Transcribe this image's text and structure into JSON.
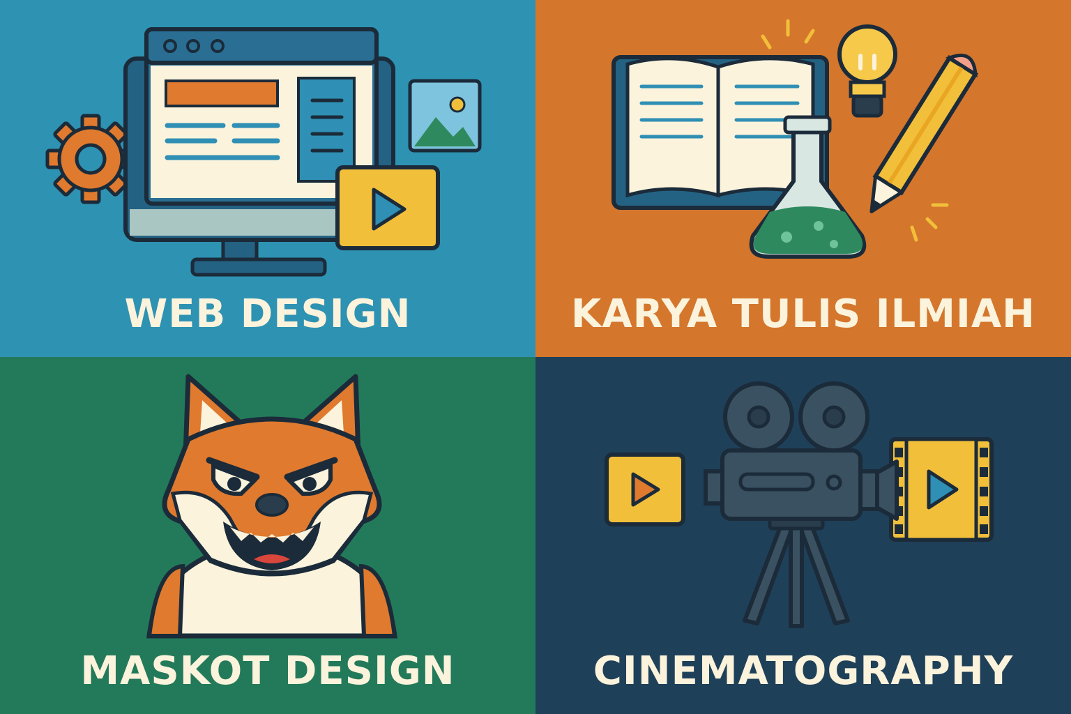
{
  "tiles": [
    {
      "label": "WEB DESIGN",
      "bg": "#2E92B2",
      "icon": "monitor-webpage-icon"
    },
    {
      "label": "KARYA TULIS ILMIAH",
      "bg": "#D4762C",
      "icon": "book-flask-pencil-icon"
    },
    {
      "label": "MASKOT DESIGN",
      "bg": "#237A5A",
      "icon": "fox-mascot-icon"
    },
    {
      "label": "CINEMATOGRAPHY",
      "bg": "#1F4059",
      "icon": "film-camera-icon"
    }
  ],
  "colors": {
    "outline": "#1B2B3A",
    "cream": "#FBF3DC",
    "orange": "#E07A2E",
    "yellow": "#F2BF3A",
    "teal": "#2F8FB4",
    "green": "#2E8A5E"
  }
}
